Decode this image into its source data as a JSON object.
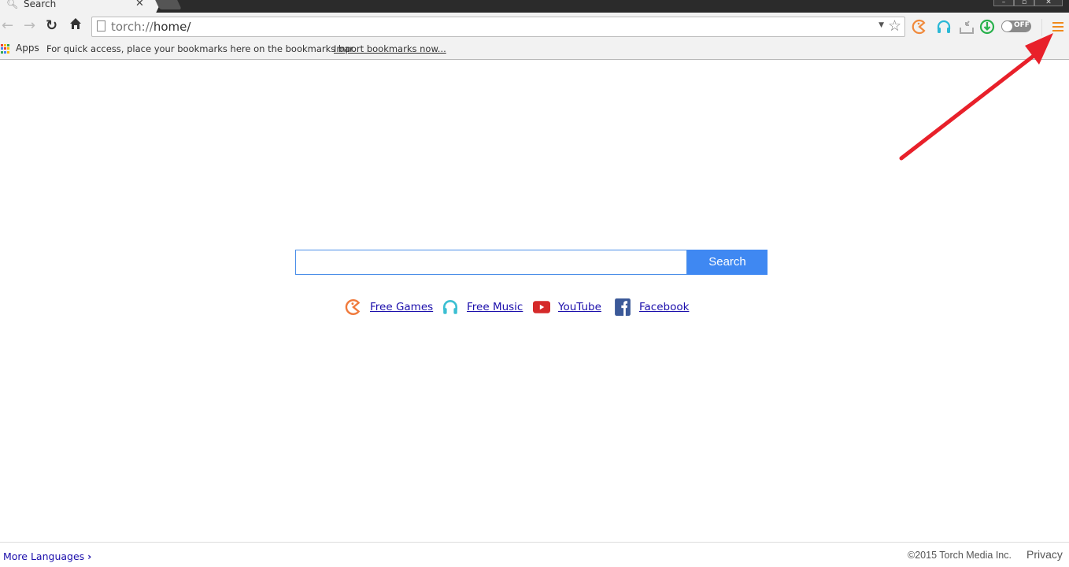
{
  "browser": {
    "tab": {
      "title": "Search",
      "icon": "search-icon"
    },
    "window_controls": [
      "minimize",
      "restore",
      "close"
    ],
    "url": {
      "scheme": "torch://",
      "path": "home/"
    },
    "extensions": [
      {
        "name": "games-icon",
        "color": "#f08a3c"
      },
      {
        "name": "music-icon",
        "color": "#2bb8d6"
      },
      {
        "name": "download-icon",
        "color": "#a0a0a0"
      },
      {
        "name": "torrent-icon",
        "color": "#28b14c"
      }
    ],
    "toggle": {
      "label": "OFF",
      "state": "off"
    },
    "menu_color": "#f08a1c"
  },
  "bookmarks": {
    "apps_label": "Apps",
    "hint": "For quick access, place your bookmarks here on the bookmarks bar.",
    "import_link": "Import bookmarks now..."
  },
  "search": {
    "input_value": "",
    "button_label": "Search",
    "button_color": "#3f88f2"
  },
  "quick_links": [
    {
      "label": "Free Games",
      "icon": "games-icon"
    },
    {
      "label": "Free Music",
      "icon": "headphones-icon"
    },
    {
      "label": "YouTube",
      "icon": "youtube-icon"
    },
    {
      "label": "Facebook",
      "icon": "facebook-icon"
    }
  ],
  "footer": {
    "more_languages": "More Languages",
    "copyright": "©2015 Torch Media Inc.",
    "privacy": "Privacy"
  },
  "annotation": {
    "type": "arrow",
    "color": "#e8202a",
    "points_to": "menu-button"
  }
}
